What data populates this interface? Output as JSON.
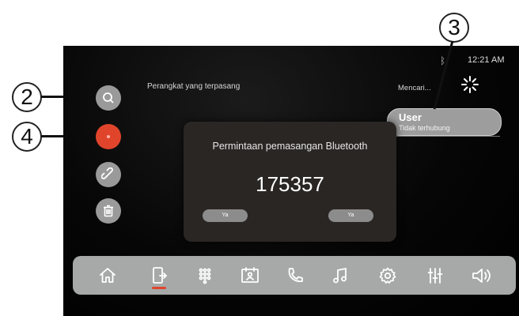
{
  "status_bar": {
    "bluetooth_icon": "bluetooth-icon",
    "time": "12:21 AM"
  },
  "left_panel": {
    "title": "Perangkat yang terpasang"
  },
  "right_panel": {
    "search_status": "Mencari...",
    "loading_icon": "spinner-icon"
  },
  "device": {
    "name": "User",
    "status": "Tidak terhubung"
  },
  "dialog": {
    "title": "Permintaan pemasangan Bluetooth",
    "code": "175357",
    "left_button": "Ya",
    "right_button": "Ya"
  },
  "side_buttons": [
    "search-icon",
    "record-icon",
    "link-icon",
    "trash-icon"
  ],
  "callouts": {
    "c2": "2",
    "c3": "3",
    "c4": "4"
  },
  "dock": [
    "home-icon",
    "phone-connect-icon",
    "keypad-icon",
    "contacts-icon",
    "call-icon",
    "music-icon",
    "settings-icon",
    "equalizer-icon",
    "volume-icon"
  ],
  "colors": {
    "accent": "#e0452c",
    "dock_bg": "#a7a9a9",
    "dialog_bg": "#2a2624"
  }
}
